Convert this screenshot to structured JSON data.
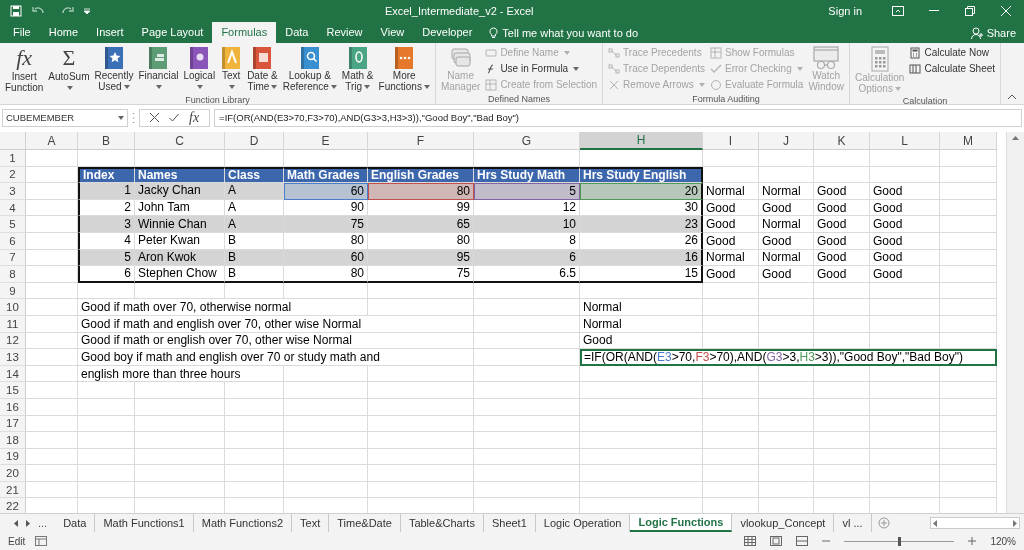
{
  "title_bar": {
    "title": "Excel_Intermediate_v2 - Excel",
    "sign_in": "Sign in"
  },
  "ribbon_tabs": [
    {
      "label": "File",
      "selected": false
    },
    {
      "label": "Home",
      "selected": false
    },
    {
      "label": "Insert",
      "selected": false
    },
    {
      "label": "Page Layout",
      "selected": false
    },
    {
      "label": "Formulas",
      "selected": true
    },
    {
      "label": "Data",
      "selected": false
    },
    {
      "label": "Review",
      "selected": false
    },
    {
      "label": "View",
      "selected": false
    },
    {
      "label": "Developer",
      "selected": false
    }
  ],
  "tell_me": "Tell me what you want to do",
  "share": "Share",
  "ribbon_groups": [
    {
      "label": "Function Library",
      "items": [
        {
          "kind": "large",
          "lines": [
            "Insert",
            "Function"
          ],
          "glyph": "fx",
          "dropdown": false,
          "disabled": false
        },
        {
          "kind": "large",
          "lines": [
            "AutoSum"
          ],
          "glyph": "Σ",
          "dropdown": true,
          "disabled": false
        },
        {
          "kind": "large",
          "lines": [
            "Recently",
            "Used"
          ],
          "dropdown": true,
          "disabled": false
        },
        {
          "kind": "large",
          "lines": [
            "Financial"
          ],
          "dropdown": true,
          "disabled": false
        },
        {
          "kind": "large",
          "lines": [
            "Logical"
          ],
          "dropdown": true,
          "disabled": false
        },
        {
          "kind": "large",
          "lines": [
            "Text"
          ],
          "dropdown": true,
          "disabled": false
        },
        {
          "kind": "large",
          "lines": [
            "Date &",
            "Time"
          ],
          "dropdown": true,
          "disabled": false
        },
        {
          "kind": "large",
          "lines": [
            "Lookup &",
            "Reference"
          ],
          "dropdown": true,
          "disabled": false
        },
        {
          "kind": "large",
          "lines": [
            "Math &",
            "Trig"
          ],
          "dropdown": true,
          "disabled": false
        },
        {
          "kind": "large",
          "lines": [
            "More",
            "Functions"
          ],
          "dropdown": true,
          "disabled": false
        }
      ]
    },
    {
      "label": "Defined Names",
      "items": [
        {
          "kind": "large",
          "lines": [
            "Name",
            "Manager"
          ],
          "dropdown": false,
          "disabled": true
        },
        {
          "kind": "stack",
          "buttons": [
            {
              "label": "Define Name",
              "dropdown": true,
              "disabled": true
            },
            {
              "label": "Use in Formula",
              "dropdown": true,
              "disabled": false
            },
            {
              "label": "Create from Selection",
              "dropdown": false,
              "disabled": true
            }
          ]
        }
      ]
    },
    {
      "label": "Formula Auditing",
      "items": [
        {
          "kind": "stack",
          "buttons": [
            {
              "label": "Trace Precedents",
              "dropdown": false,
              "disabled": true
            },
            {
              "label": "Trace Dependents",
              "dropdown": false,
              "disabled": true
            },
            {
              "label": "Remove Arrows",
              "dropdown": true,
              "disabled": true
            }
          ]
        },
        {
          "kind": "stack",
          "buttons": [
            {
              "label": "Show Formulas",
              "dropdown": false,
              "disabled": true
            },
            {
              "label": "Error Checking",
              "dropdown": true,
              "disabled": true
            },
            {
              "label": "Evaluate Formula",
              "dropdown": false,
              "disabled": true
            }
          ]
        },
        {
          "kind": "large",
          "lines": [
            "Watch",
            "Window"
          ],
          "dropdown": false,
          "disabled": true
        }
      ]
    },
    {
      "label": "Calculation",
      "items": [
        {
          "kind": "large",
          "lines": [
            "Calculation",
            "Options"
          ],
          "dropdown": true,
          "disabled": true
        },
        {
          "kind": "stack",
          "buttons": [
            {
              "label": "Calculate Now",
              "dropdown": false,
              "disabled": false
            },
            {
              "label": "Calculate Sheet",
              "dropdown": false,
              "disabled": false
            }
          ]
        }
      ]
    }
  ],
  "formula_bar": {
    "name_box": "CUBEMEMBER",
    "function_glyph": "fx",
    "formula": "=IF(OR(AND(E3>70,F3>70),AND(G3>3,H3>3)),\"Good Boy\",\"Bad Boy\")"
  },
  "columns": [
    {
      "label": "A",
      "selected": false
    },
    {
      "label": "B",
      "selected": false
    },
    {
      "label": "C",
      "selected": false
    },
    {
      "label": "D",
      "selected": false
    },
    {
      "label": "E",
      "selected": false
    },
    {
      "label": "F",
      "selected": false
    },
    {
      "label": "G",
      "selected": false
    },
    {
      "label": "H",
      "selected": true
    },
    {
      "label": "I",
      "selected": false
    },
    {
      "label": "J",
      "selected": false
    },
    {
      "label": "K",
      "selected": false
    },
    {
      "label": "L",
      "selected": false
    },
    {
      "label": "M",
      "selected": false
    }
  ],
  "rows": [
    {
      "number": "1"
    },
    {
      "number": "2",
      "kind": "table-header",
      "cells": [
        null,
        "Index",
        "Names",
        "Class",
        "Math Grades",
        "English Grades",
        "Hrs Study Math",
        "Hrs Study English"
      ]
    },
    {
      "number": "3",
      "kind": "table-band",
      "cells": [
        null,
        "1",
        "Jacky Chan",
        "A",
        {
          "text": "60",
          "color": "#4a7cc7"
        },
        {
          "text": "80",
          "color": "#c0504d"
        },
        {
          "text": "5",
          "color": "#8064a2"
        },
        {
          "text": "20",
          "color": "#4e9a5b"
        },
        "Normal",
        "Normal",
        "Good",
        "Good"
      ]
    },
    {
      "number": "4",
      "kind": "table-row",
      "cells": [
        null,
        "2",
        "John Tam",
        "A",
        "90",
        "99",
        "12",
        "30",
        "Good",
        "Good",
        "Good",
        "Good"
      ]
    },
    {
      "number": "5",
      "kind": "table-band",
      "cells": [
        null,
        "3",
        "Winnie Chan",
        "A",
        "75",
        "65",
        "10",
        "23",
        "Good",
        "Normal",
        "Good",
        "Good"
      ]
    },
    {
      "number": "6",
      "kind": "table-row",
      "cells": [
        null,
        "4",
        "Peter Kwan",
        "B",
        "80",
        "80",
        "8",
        "26",
        "Good",
        "Good",
        "Good",
        "Good"
      ]
    },
    {
      "number": "7",
      "kind": "table-band",
      "cells": [
        null,
        "5",
        "Aron Kwok",
        "B",
        "60",
        "95",
        "6",
        "16",
        "Normal",
        "Normal",
        "Good",
        "Good"
      ]
    },
    {
      "number": "8",
      "kind": "table-row",
      "cells": [
        null,
        "6",
        "Stephen Chow",
        "B",
        "80",
        "75",
        "6.5",
        "15",
        "Good",
        "Good",
        "Good",
        "Good"
      ]
    },
    {
      "number": "9"
    },
    {
      "number": "10",
      "cells": [
        null,
        "Good if math over 70, otherwise normal",
        null,
        null,
        null,
        null,
        null,
        "Normal"
      ]
    },
    {
      "number": "11",
      "cells": [
        null,
        "Good if math and english over 70, other wise Normal",
        null,
        null,
        null,
        null,
        null,
        "Normal"
      ]
    },
    {
      "number": "12",
      "cells": [
        null,
        "Good if math or english over 70, other wise Normal",
        null,
        null,
        null,
        null,
        null,
        "Good"
      ]
    },
    {
      "number": "13",
      "cells": [
        null,
        "Good boy if math and english over 70 or study math and",
        null,
        null,
        null,
        null,
        null,
        {
          "kind": "editing",
          "segments": [
            {
              "text": "=IF(OR(AND(",
              "color": "#000000"
            },
            {
              "text": "E3",
              "color": "#4a7cc7"
            },
            {
              "text": ">70,",
              "color": "#000000"
            },
            {
              "text": "F3",
              "color": "#c0504d"
            },
            {
              "text": ">70),AND(",
              "color": "#000000"
            },
            {
              "text": "G3",
              "color": "#8064a2"
            },
            {
              "text": ">3,",
              "color": "#000000"
            },
            {
              "text": "H3",
              "color": "#4e9a5b"
            },
            {
              "text": ">3)),\"Good Boy\",\"Bad Boy\")",
              "color": "#000000"
            }
          ]
        }
      ]
    },
    {
      "number": "14",
      "cells": [
        null,
        "english more than three hours"
      ]
    },
    {
      "number": "15"
    },
    {
      "number": "16"
    },
    {
      "number": "17"
    },
    {
      "number": "18"
    },
    {
      "number": "19"
    },
    {
      "number": "20"
    },
    {
      "number": "21"
    },
    {
      "number": "22"
    }
  ],
  "sheet_tabs": {
    "more": "...",
    "tabs": [
      {
        "label": "Data",
        "selected": false
      },
      {
        "label": "Math Functions1",
        "selected": false
      },
      {
        "label": "Math Functions2",
        "selected": false
      },
      {
        "label": "Text",
        "selected": false
      },
      {
        "label": "Time&Date",
        "selected": false
      },
      {
        "label": "Table&Charts",
        "selected": false
      },
      {
        "label": "Sheet1",
        "selected": false
      },
      {
        "label": "Logic Operation",
        "selected": false
      },
      {
        "label": "Logic Functions",
        "selected": true
      },
      {
        "label": "vlookup_Concept",
        "selected": false
      },
      {
        "label": "vl ...",
        "selected": false
      }
    ]
  },
  "status_bar": {
    "mode": "Edit",
    "zoom": {
      "level": 0.5,
      "reading": "120%"
    }
  }
}
